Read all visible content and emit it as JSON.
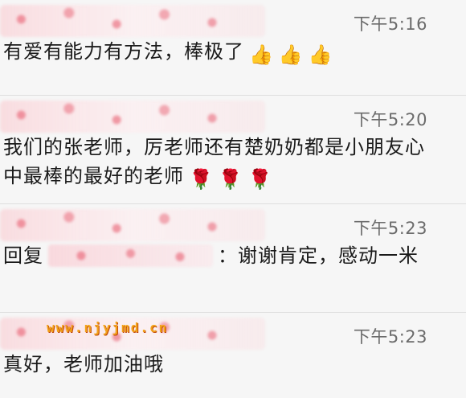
{
  "comments": [
    {
      "time": "下午5:16",
      "text": "有爱有能力有方法，棒极了",
      "emojis": [
        "thumbs-up",
        "thumbs-up",
        "thumbs-up"
      ]
    },
    {
      "time": "下午5:20",
      "text": "我们的张老师，厉老师还有楚奶奶都是小朋友心中最棒的最好的老师",
      "emojis": [
        "rose",
        "rose",
        "rose"
      ]
    },
    {
      "time": "下午5:23",
      "reply_prefix": "回复",
      "text": "：谢谢肯定，感动一米"
    },
    {
      "time": "下午5:23",
      "text": "真好，老师加油哦"
    }
  ],
  "watermark": "www.njyjmd.cn",
  "glyphs": {
    "thumbs-up": "👍",
    "rose": "🌹"
  }
}
